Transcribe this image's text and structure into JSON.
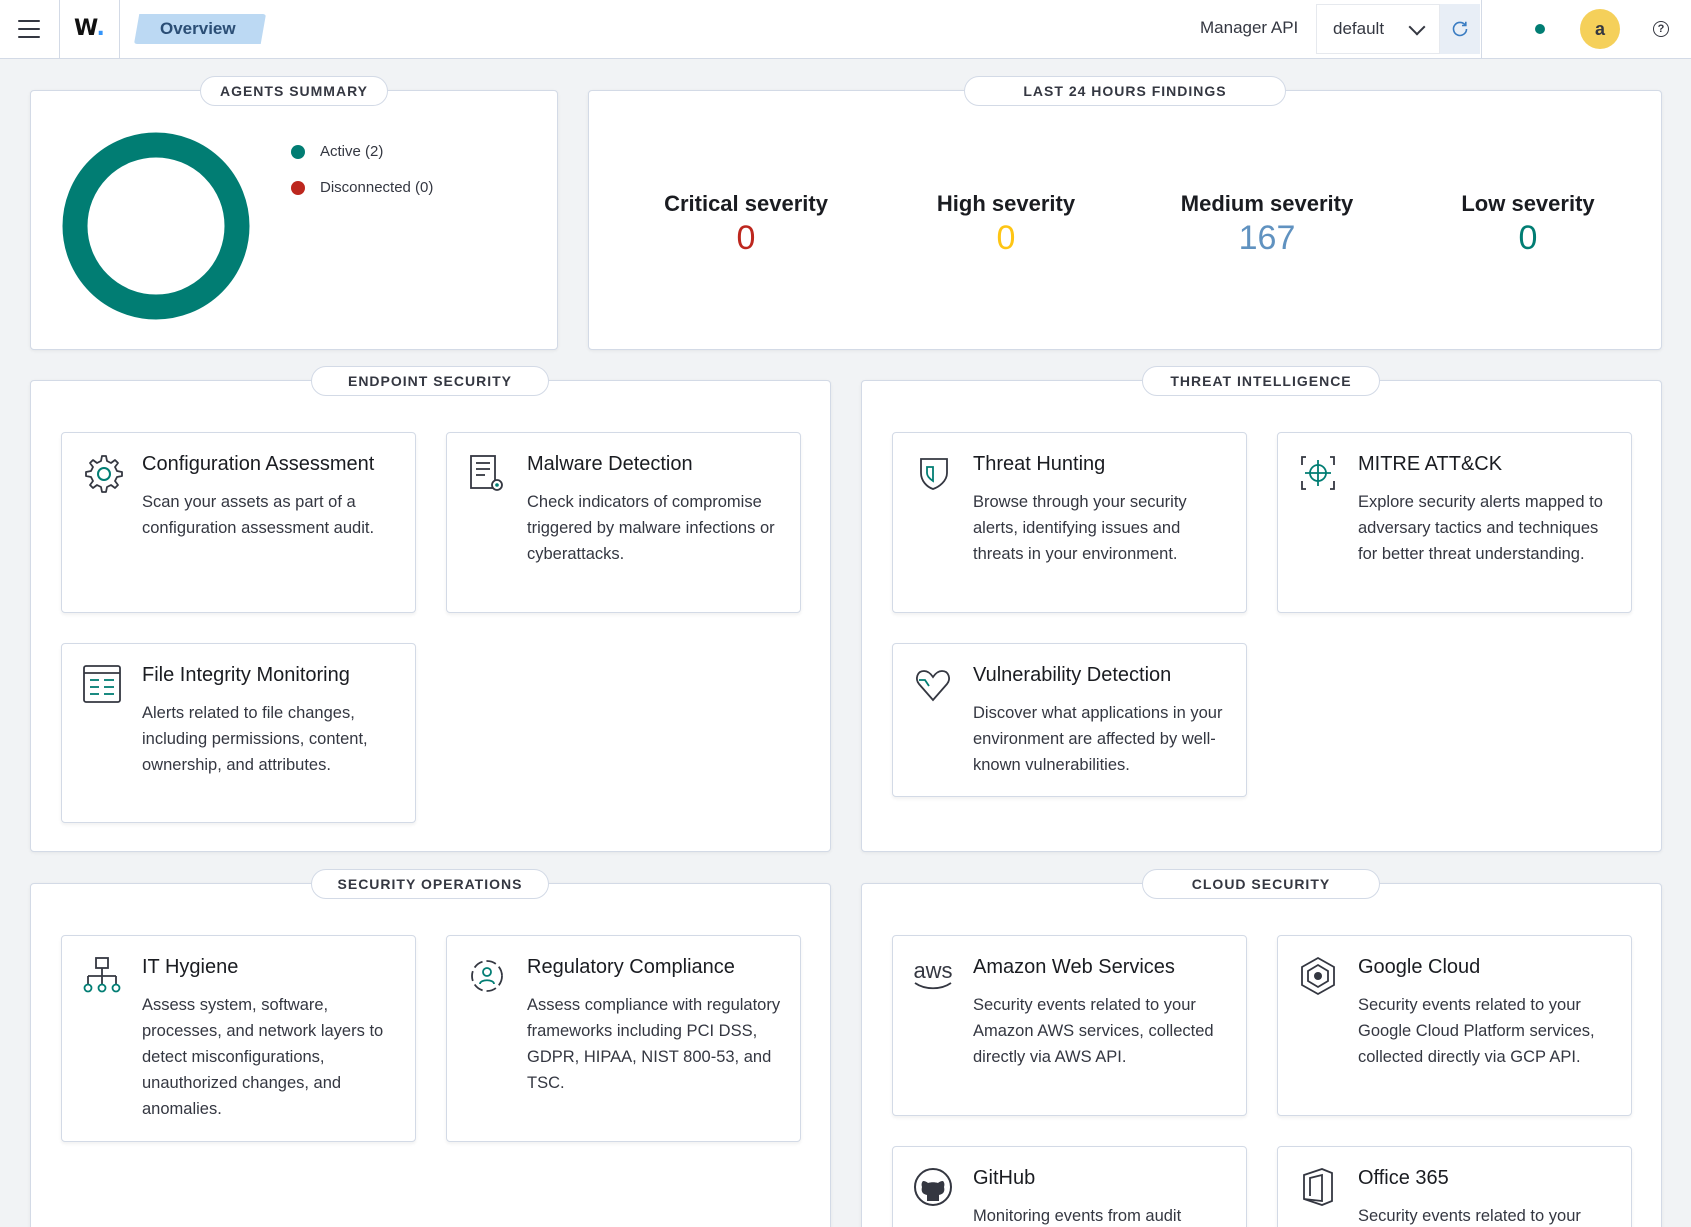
{
  "header": {
    "logo_text": "W",
    "logo_dot": ".",
    "breadcrumb": "Overview",
    "manager_label": "Manager API",
    "api_value": "default",
    "avatar_initial": "a",
    "help_glyph": "?",
    "status_color": "#017d73",
    "avatar_color": "#f5d05a"
  },
  "agents_summary": {
    "title": "AGENTS SUMMARY",
    "donut_color": "#017d73",
    "legend": [
      {
        "label": "Active (2)",
        "color": "#017d73"
      },
      {
        "label": "Disconnected (0)",
        "color": "#bd271e"
      }
    ],
    "chart_data": {
      "type": "pie",
      "categories": [
        "Active",
        "Disconnected"
      ],
      "values": [
        2,
        0
      ]
    }
  },
  "findings": {
    "title": "LAST 24 HOURS FINDINGS",
    "items": [
      {
        "label": "Critical severity",
        "value": "0",
        "color": "#bd271e"
      },
      {
        "label": "High severity",
        "value": "0",
        "color": "#fec514"
      },
      {
        "label": "Medium severity",
        "value": "167",
        "color": "#6092c0"
      },
      {
        "label": "Low severity",
        "value": "0",
        "color": "#017d73"
      }
    ]
  },
  "sections": {
    "endpoint": {
      "title": "ENDPOINT SECURITY",
      "cards": [
        {
          "icon": "gear-icon",
          "title": "Configuration Assessment",
          "desc": "Scan your assets as part of a configuration assessment audit."
        },
        {
          "icon": "document-gear-icon",
          "title": "Malware Detection",
          "desc": "Check indicators of compromise triggered by malware infections or cyberattacks."
        },
        {
          "icon": "list-icon",
          "title": "File Integrity Monitoring",
          "desc": "Alerts related to file changes, including permissions, content, ownership, and attributes."
        }
      ]
    },
    "threat": {
      "title": "THREAT INTELLIGENCE",
      "cards": [
        {
          "icon": "shield-icon",
          "title": "Threat Hunting",
          "desc": "Browse through your security alerts, identifying issues and threats in your environment."
        },
        {
          "icon": "crosshair-icon",
          "title": "MITRE ATT&CK",
          "desc": "Explore security alerts mapped to adversary tactics and techniques for better threat understanding."
        },
        {
          "icon": "heart-icon",
          "title": "Vulnerability Detection",
          "desc": "Discover what applications in your environment are affected by well-known vulnerabilities."
        }
      ]
    },
    "secops": {
      "title": "SECURITY OPERATIONS",
      "cards": [
        {
          "icon": "network-icon",
          "title": "IT Hygiene",
          "desc": "Assess system, software, processes, and network layers to detect misconfigurations, unauthorized changes, and anomalies."
        },
        {
          "icon": "compliance-icon",
          "title": "Regulatory Compliance",
          "desc": "Assess compliance with regulatory frameworks including PCI DSS, GDPR, HIPAA, NIST 800-53, and TSC."
        }
      ]
    },
    "cloud": {
      "title": "CLOUD SECURITY",
      "cards": [
        {
          "icon": "aws-icon",
          "icon_text": "aws",
          "title": "Amazon Web Services",
          "desc": "Security events related to your Amazon AWS services, collected directly via AWS API."
        },
        {
          "icon": "google-cloud-icon",
          "title": "Google Cloud",
          "desc": "Security events related to your Google Cloud Platform services, collected directly via GCP API."
        },
        {
          "icon": "github-icon",
          "title": "GitHub",
          "desc": "Monitoring events from audit"
        },
        {
          "icon": "office-icon",
          "title": "Office 365",
          "desc": "Security events related to your"
        }
      ]
    }
  }
}
